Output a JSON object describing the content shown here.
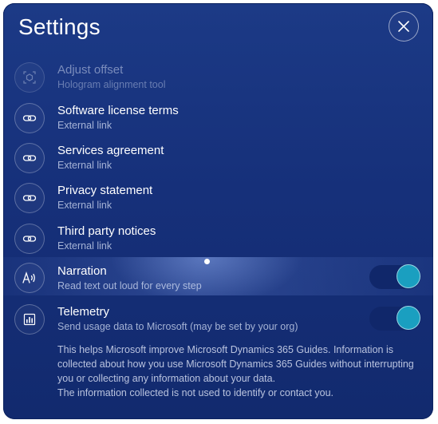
{
  "header": {
    "title": "Settings",
    "close_icon": "close-icon"
  },
  "items": [
    {
      "label": "Adjust offset",
      "sub": "Hologram alignment tool",
      "icon": "hologram-offset-icon",
      "enabled": false
    },
    {
      "label": "Software license terms",
      "sub": "External link",
      "icon": "link-icon",
      "enabled": true
    },
    {
      "label": "Services agreement",
      "sub": "External link",
      "icon": "link-icon",
      "enabled": true
    },
    {
      "label": "Privacy statement",
      "sub": "External link",
      "icon": "link-icon",
      "enabled": true
    },
    {
      "label": "Third party notices",
      "sub": "External link",
      "icon": "link-icon",
      "enabled": true
    },
    {
      "label": "Narration",
      "sub": "Read text out loud for every step",
      "icon": "narration-icon",
      "toggle_on": true
    },
    {
      "label": "Telemetry",
      "sub": "Send usage data to Microsoft (may be set by your org)",
      "icon": "telemetry-icon",
      "toggle_on": true
    }
  ],
  "info": {
    "line1": "This helps Microsoft improve Microsoft Dynamics 365 Guides. Information is collected about how you use Microsoft Dynamics 365 Guides without interrupting you or collecting any information about your data.",
    "line2": "The information collected is not used to identify or contact you."
  },
  "colors": {
    "panel": "#16307a",
    "toggle_knob": "#1a9fc0",
    "toggle_track": "#10276a"
  }
}
